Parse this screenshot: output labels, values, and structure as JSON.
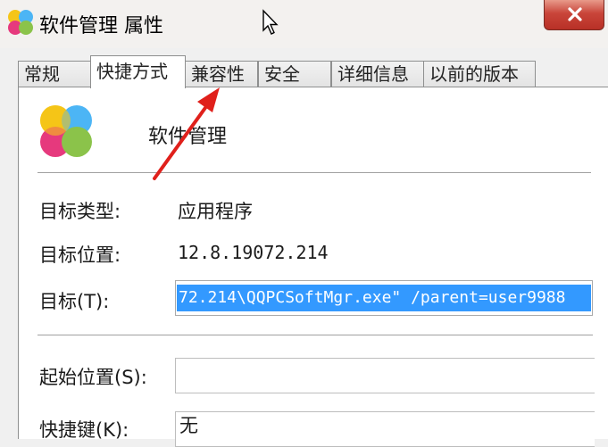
{
  "window": {
    "title": "软件管理 属性",
    "app_icon": "four-petal-flower-icon",
    "close_icon": "close-icon"
  },
  "tabs": [
    {
      "label": "常规",
      "active": false
    },
    {
      "label": "快捷方式",
      "active": true
    },
    {
      "label": "兼容性",
      "active": false
    },
    {
      "label": "安全",
      "active": false
    },
    {
      "label": "详细信息",
      "active": false
    },
    {
      "label": "以前的版本",
      "active": false
    }
  ],
  "shortcut": {
    "app_name": "软件管理",
    "target_type_label": "目标类型:",
    "target_type_value": "应用程序",
    "target_location_label": "目标位置:",
    "target_location_value": "12.8.19072.214",
    "target_label": "目标(T):",
    "target_value": "72.214\\QQPCSoftMgr.exe\" /parent=user9988",
    "start_in_label": "起始位置(S):",
    "start_in_value": "",
    "hotkey_label": "快捷键(K):",
    "hotkey_value": "无"
  },
  "colors": {
    "selection": "#3399ff",
    "close_button": "#c9453a",
    "annotation_arrow": "#e0201b"
  }
}
